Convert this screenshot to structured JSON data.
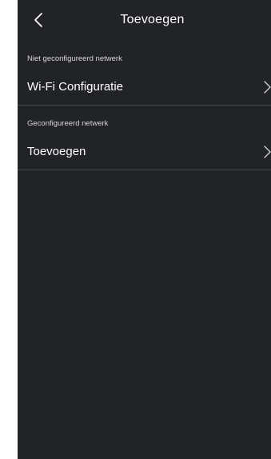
{
  "header": {
    "title": "Toevoegen",
    "back_icon": "chevron-left-icon"
  },
  "sections": [
    {
      "label": "Niet geconfigureerd netwerk",
      "items": [
        {
          "label": "Wi-Fi Configuratie",
          "icon": "chevron-right-icon"
        }
      ]
    },
    {
      "label": "Geconfigureerd netwerk",
      "items": [
        {
          "label": "Toevoegen",
          "icon": "chevron-right-icon"
        }
      ]
    }
  ],
  "colors": {
    "background": "#222326",
    "divider": "#45464a",
    "text": "#ffffff"
  }
}
